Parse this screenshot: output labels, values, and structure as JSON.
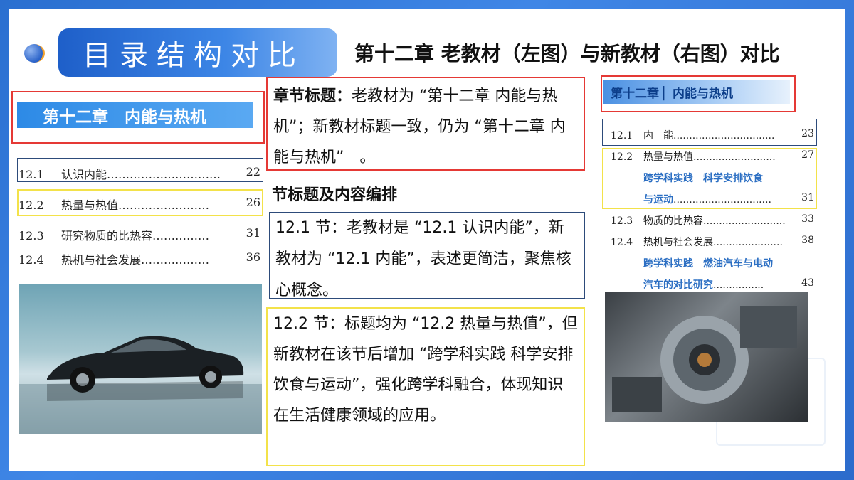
{
  "slide": {
    "title": "目录结构对比",
    "subtitle": "第十二章 老教材（左图）与新教材（右图）对比"
  },
  "left": {
    "chapter_banner": "第十二章　内能与热机",
    "toc": [
      {
        "num": "12.1",
        "title": "认识内能",
        "dots": "…………………………",
        "page": "22"
      },
      {
        "num": "12.2",
        "title": "热量与热值",
        "dots": "……………………",
        "page": "26"
      },
      {
        "num": "12.3",
        "title": "研究物质的比热容",
        "dots": "……………",
        "page": "31"
      },
      {
        "num": "12.4",
        "title": "热机与社会发展",
        "dots": "………………",
        "page": "36"
      }
    ]
  },
  "middle": {
    "chapter_title_label": "章节标题：",
    "chapter_title_text": "老教材为 “第十二章 内能与热机”；新教材标题一致，仍为 “第十二章 内能与热机”　。",
    "section_heading": "节标题及内容编排",
    "p1": "12.1 节：老教材是 “12.1 认识内能”，新教材为 “12.1 内能”，表述更简洁，聚焦核心概念。",
    "p2": "12.2 节：标题均为 “12.2 热量与热值”，但新教材在该节后增加 “跨学科实践 科学安排饮食与运动”，强化跨学科融合，体现知识在生活健康领域的应用。"
  },
  "right": {
    "chapter_banner": "第十二章 ▏内能与热机",
    "toc": [
      {
        "num": "12.1",
        "title": "内　能",
        "dots": "................................",
        "page": "23"
      },
      {
        "num": "12.2",
        "title": "热量与热值",
        "dots": "..........................",
        "page": "27"
      },
      {
        "sub1": "跨学科实践　科学安排饮食",
        "sub2": "与运动",
        "dots": "...............................",
        "page": "31"
      },
      {
        "num": "12.3",
        "title": "物质的比热容",
        "dots": "..........................",
        "page": "33"
      },
      {
        "num": "12.4",
        "title": "热机与社会发展",
        "dots": "......................",
        "page": "38"
      },
      {
        "sub1": "跨学科实践　燃油汽车与电动",
        "sub2": "汽车的对比研究",
        "dots": "................",
        "page": "43"
      }
    ]
  },
  "colors": {
    "accent_blue": "#2d8ae6",
    "red_box": "#e53935",
    "yellow_box": "#f3e24a",
    "navy_box": "#2d4b7a"
  }
}
